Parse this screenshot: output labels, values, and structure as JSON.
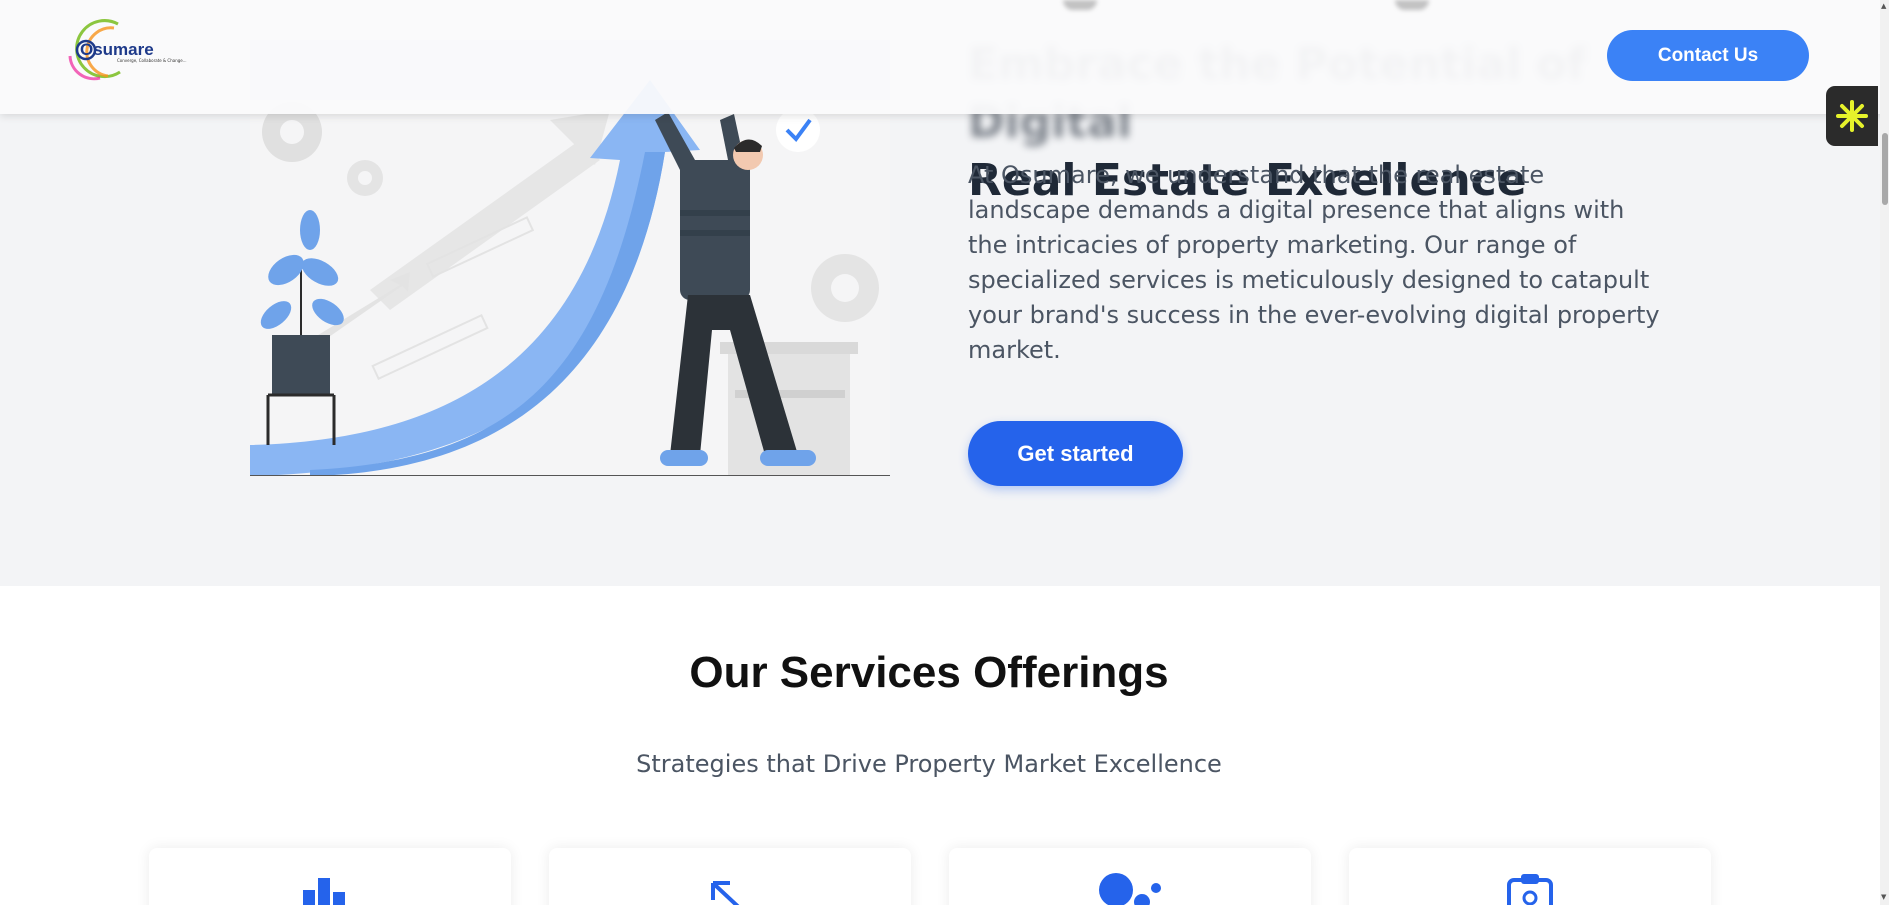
{
  "header": {
    "logo_name": "Osumare",
    "logo_tagline": "Converge, Collaborate & Change...",
    "contact_button": "Contact Us"
  },
  "hero": {
    "title_line_1": "Embrace the Potential of Digital",
    "title_line_2": "Real Estate Excellence",
    "description": "At Osumare, we understand that the real estate landscape demands a digital presence that aligns with the intricacies of property marketing. Our range of specialized services is meticulously designed to catapult your brand's success in the ever-evolving digital property market.",
    "cta_button": "Get started"
  },
  "services": {
    "title": "Our Services Offerings",
    "subtitle": "Strategies that Drive Property Market Excellence",
    "cards": [
      {
        "icon": "bar-chart-icon"
      },
      {
        "icon": "arrow-up-left-icon"
      },
      {
        "icon": "dots-icon"
      },
      {
        "icon": "clipboard-icon"
      }
    ]
  },
  "widget": {
    "icon": "asterisk-icon"
  },
  "colors": {
    "primary": "#2563eb",
    "primary_light": "#3b82f6",
    "hero_bg": "#f3f4f6",
    "widget_accent": "#e6f22b"
  }
}
